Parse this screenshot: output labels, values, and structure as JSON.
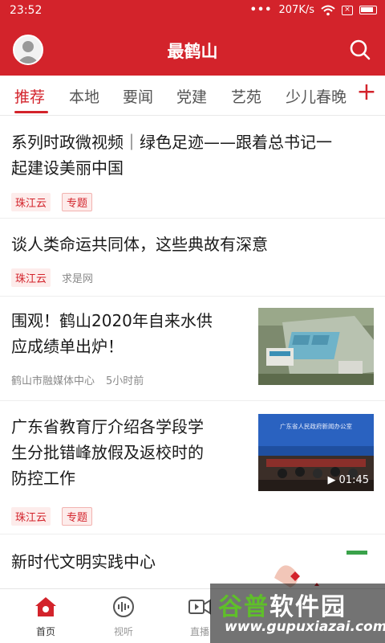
{
  "status_bar": {
    "time": "23:52",
    "speed": "207K/s"
  },
  "header": {
    "title": "最鹤山"
  },
  "tabs": [
    {
      "label": "推荐",
      "active": true
    },
    {
      "label": "本地"
    },
    {
      "label": "要闻"
    },
    {
      "label": "党建"
    },
    {
      "label": "艺苑"
    },
    {
      "label": "少儿春晚"
    }
  ],
  "articles": [
    {
      "title_line1": "系列时政微视频｜绿色足迹——跟着总书记一",
      "title_line2": "起建设美丽中国",
      "source": "珠江云",
      "tag": "专题"
    },
    {
      "title_line1": "谈人类命运共同体，这些典故有深意",
      "source": "珠江云",
      "publisher": "求是网"
    },
    {
      "title_line1": "围观！鹤山2020年自来水供",
      "title_line2": "应成绩单出炉！",
      "publisher": "鹤山市融媒体中心",
      "time_ago": "5小时前"
    },
    {
      "title_line1": "广东省教育厅介绍各学段学",
      "title_line2": "生分批错峰放假及返校时的",
      "title_line3": "防控工作",
      "source": "珠江云",
      "tag": "专题",
      "video_duration": "01:45",
      "banner_text": "广东省人民政府新闻办公室"
    },
    {
      "title_line1": "新时代文明实践中心"
    }
  ],
  "bottom_nav": [
    {
      "label": "首页",
      "icon": "home-icon",
      "active": true
    },
    {
      "label": "视听",
      "icon": "audio-icon"
    },
    {
      "label": "直播",
      "icon": "live-video-icon"
    }
  ],
  "watermark": {
    "title_green": "谷普",
    "title_white": "软件园",
    "url": "www.gupuxiazai.com"
  },
  "colors": {
    "brand_red": "#d3232b",
    "tag_bg": "#fdeceb",
    "watermark_green": "#5fbf2a"
  }
}
